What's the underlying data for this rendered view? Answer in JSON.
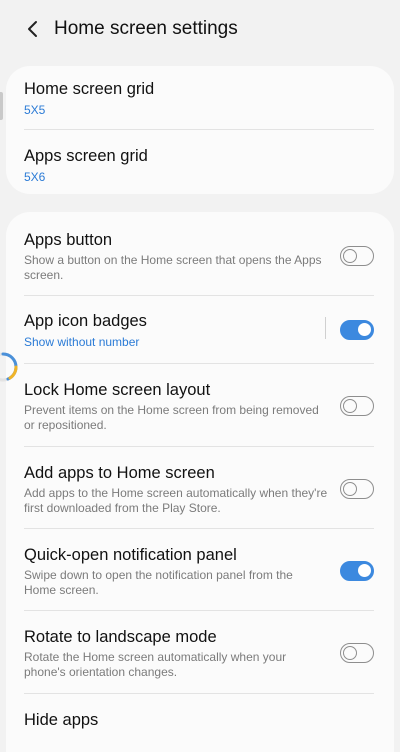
{
  "header": {
    "title": "Home screen settings"
  },
  "grid_section": {
    "items": [
      {
        "title": "Home screen grid",
        "value": "5X5"
      },
      {
        "title": "Apps screen grid",
        "value": "5X6"
      }
    ]
  },
  "settings": {
    "apps_button": {
      "title": "Apps button",
      "subtitle": "Show a button on the Home screen that opens the Apps screen.",
      "enabled": false
    },
    "app_icon_badges": {
      "title": "App icon badges",
      "value": "Show without number",
      "enabled": true
    },
    "lock_layout": {
      "title": "Lock Home screen layout",
      "subtitle": "Prevent items on the Home screen from being removed or repositioned.",
      "enabled": false
    },
    "add_apps": {
      "title": "Add apps to Home screen",
      "subtitle": "Add apps to the Home screen automatically when they're first downloaded from the Play Store.",
      "enabled": false
    },
    "quick_open": {
      "title": "Quick-open notification panel",
      "subtitle": "Swipe down to open the notification panel from the Home screen.",
      "enabled": true
    },
    "rotate": {
      "title": "Rotate to landscape mode",
      "subtitle": "Rotate the Home screen automatically when your phone's orientation changes.",
      "enabled": false
    },
    "hide_apps": {
      "title": "Hide apps"
    }
  },
  "colors": {
    "accent": "#3c89df",
    "link": "#2b7bd6",
    "background": "#f2f2f2",
    "card": "#fbfbfb"
  },
  "icons": {
    "back": "chevron-left-icon",
    "loading": "loading-spinner-icon"
  }
}
